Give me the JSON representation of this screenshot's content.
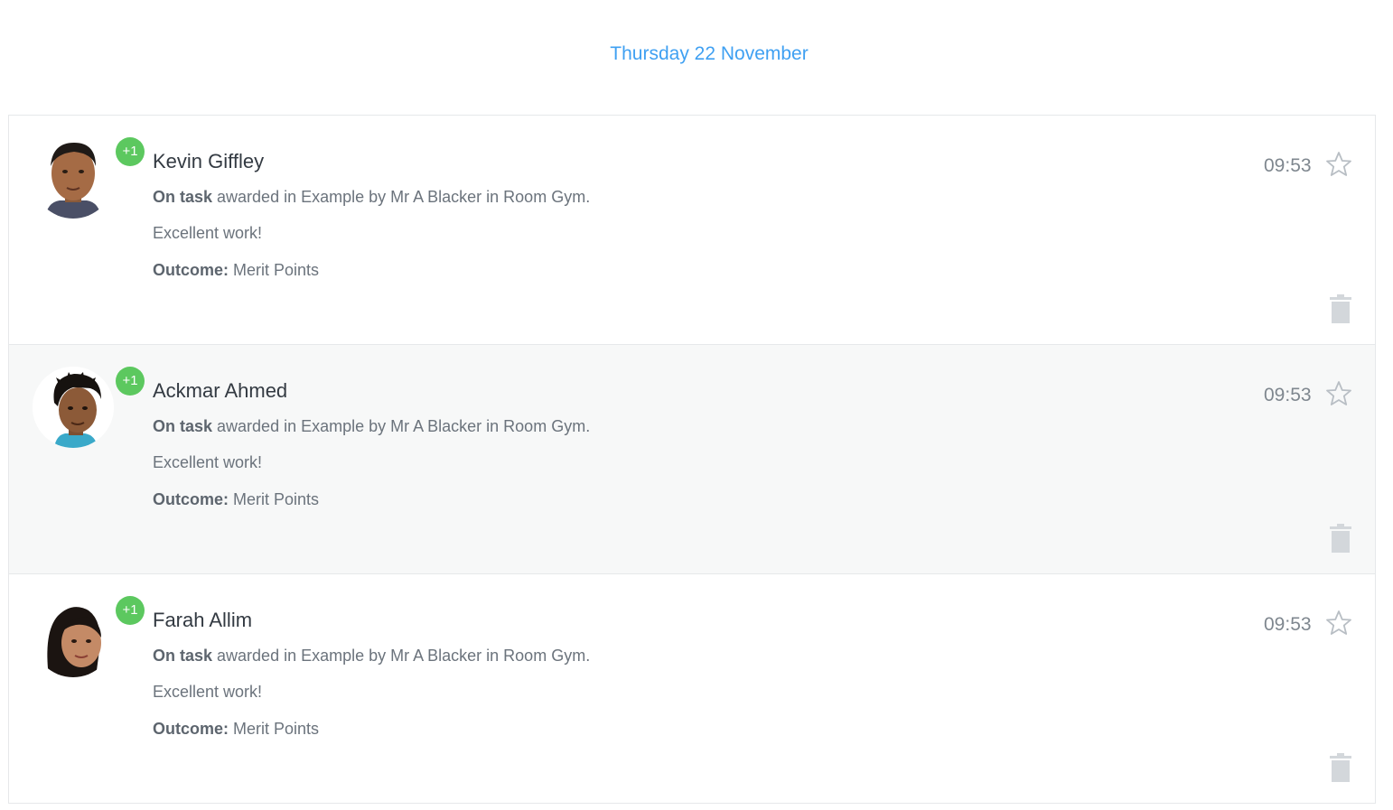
{
  "date_header": "Thursday 22 November",
  "colors": {
    "accent": "#3fa0f2",
    "badge": "#5cc85f",
    "alt_row": "#f7f8f8"
  },
  "items": [
    {
      "name": "Kevin Giffley",
      "badge": "+1",
      "behaviour": "On task",
      "detail": " awarded in Example by Mr A Blacker in Room Gym.",
      "comment": "Excellent work!",
      "outcome_label": "Outcome:",
      "outcome_value": " Merit Points",
      "time": "09:53",
      "star_icon": "star-outline-icon",
      "delete_icon": "trash-icon"
    },
    {
      "name": "Ackmar Ahmed",
      "badge": "+1",
      "behaviour": "On task",
      "detail": " awarded in Example by Mr A Blacker in Room Gym.",
      "comment": "Excellent work!",
      "outcome_label": "Outcome:",
      "outcome_value": " Merit Points",
      "time": "09:53",
      "star_icon": "star-outline-icon",
      "delete_icon": "trash-icon"
    },
    {
      "name": "Farah Allim",
      "badge": "+1",
      "behaviour": "On task",
      "detail": " awarded in Example by Mr A Blacker in Room Gym.",
      "comment": "Excellent work!",
      "outcome_label": "Outcome:",
      "outcome_value": " Merit Points",
      "time": "09:53",
      "star_icon": "star-outline-icon",
      "delete_icon": "trash-icon"
    }
  ]
}
